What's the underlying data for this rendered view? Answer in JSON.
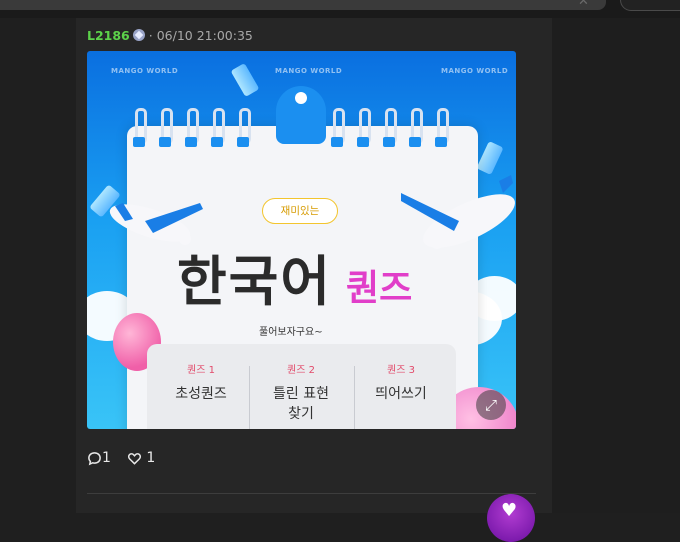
{
  "post": {
    "username": "L2186",
    "timestamp": "· 06/10 21:00:35"
  },
  "banner": {
    "watermark": "MANGO WORLD",
    "tagline": "재미있는",
    "title_main": "한국어",
    "title_accent": "퀀즈",
    "subtitle": "풀어보자구요~",
    "quizzes": [
      {
        "number": "퀀즈 1",
        "name": "초성퀀즈"
      },
      {
        "number": "퀀즈 2",
        "name": "틀린 표현 찾기"
      },
      {
        "number": "퀀즈 3",
        "name": "띄어쓰기"
      }
    ],
    "colors": {
      "sky": "#1aa0f2",
      "accent": "#e13ec9",
      "tag_border": "#f3c52e"
    }
  },
  "actions": {
    "comments_count": "1",
    "likes_count": "1"
  },
  "icons": {
    "comment": "comment-icon",
    "like": "heart-icon",
    "expand": "expand-icon",
    "badge": "level-badge-icon"
  }
}
